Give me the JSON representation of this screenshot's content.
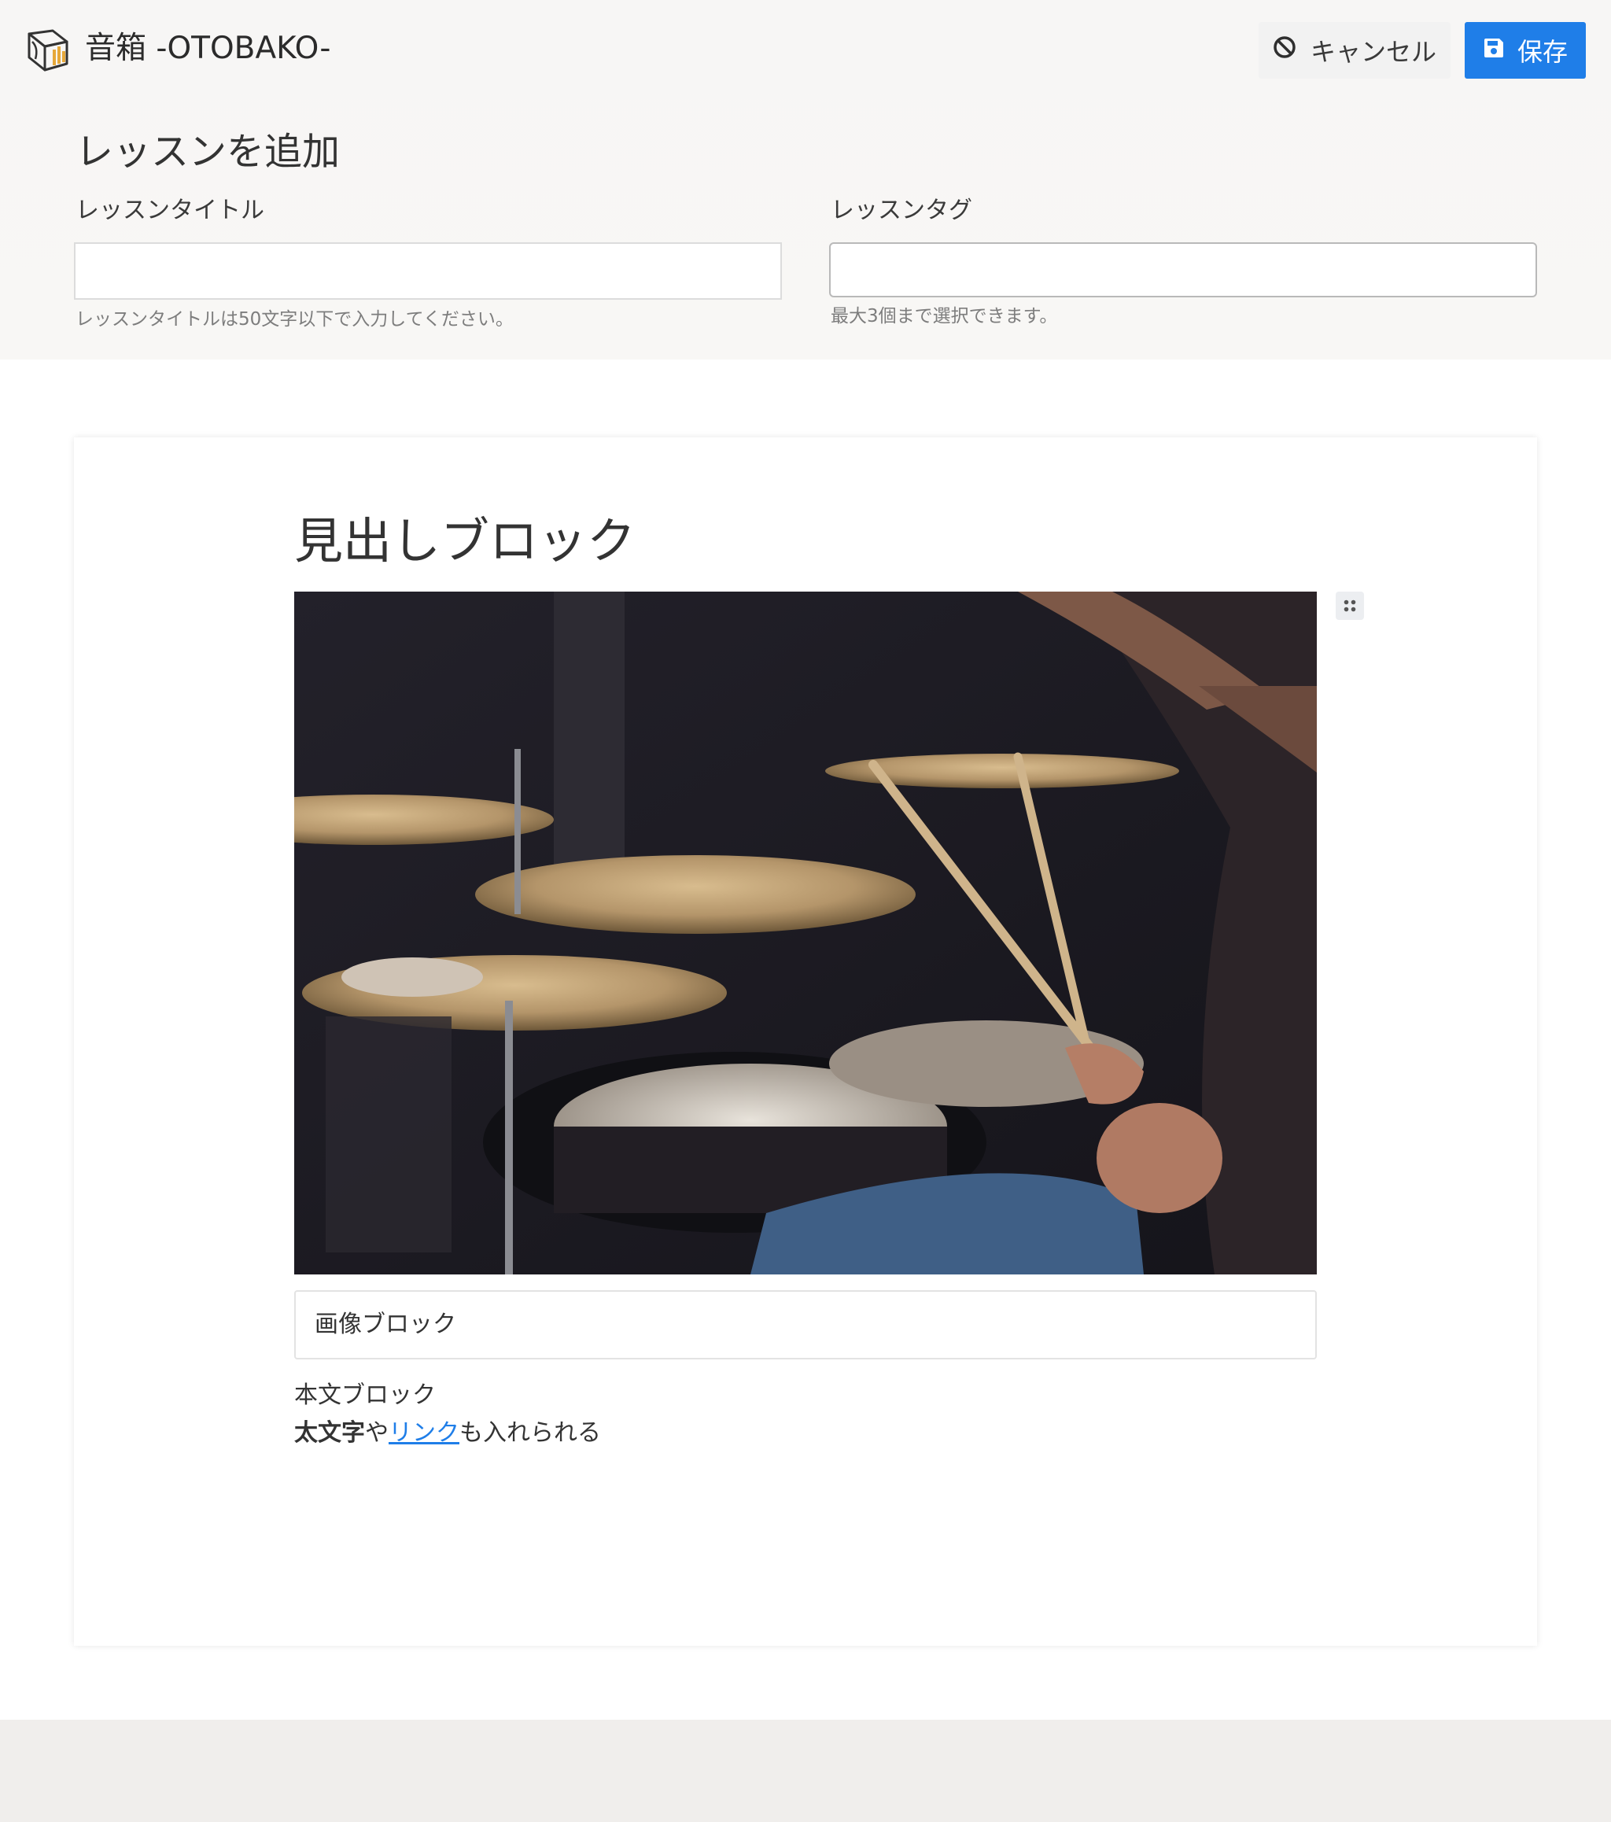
{
  "app": {
    "title": "音箱 -OTOBAKO-",
    "logo_icon": "otobako-box-logo-icon"
  },
  "header": {
    "cancel_label": "キャンセル",
    "cancel_icon": "ban-icon",
    "save_label": "保存",
    "save_icon": "floppy-disk-icon"
  },
  "page": {
    "title": "レッスンを追加"
  },
  "form": {
    "title_label": "レッスンタイトル",
    "title_value": "",
    "title_help": "レッスンタイトルは50文字以下で入力してください。",
    "tags_label": "レッスンタグ",
    "tags_value": "",
    "tags_help": "最大3個まで選択できます。"
  },
  "editor": {
    "heading_block": "見出しブロック",
    "image_alt": "drummer playing drum kit with cymbals",
    "drag_handle_icon": "drag-handle-icon",
    "image_caption": "画像ブロック",
    "paragraph_line1": "本文ブロック",
    "paragraph_bold": "太文字",
    "paragraph_mid": "や",
    "paragraph_link": "リンク",
    "paragraph_tail": "も入れられる"
  },
  "colors": {
    "accent": "#1f7ee8",
    "top_background": "#f7f6f5",
    "footer_background": "#f0eeec"
  }
}
